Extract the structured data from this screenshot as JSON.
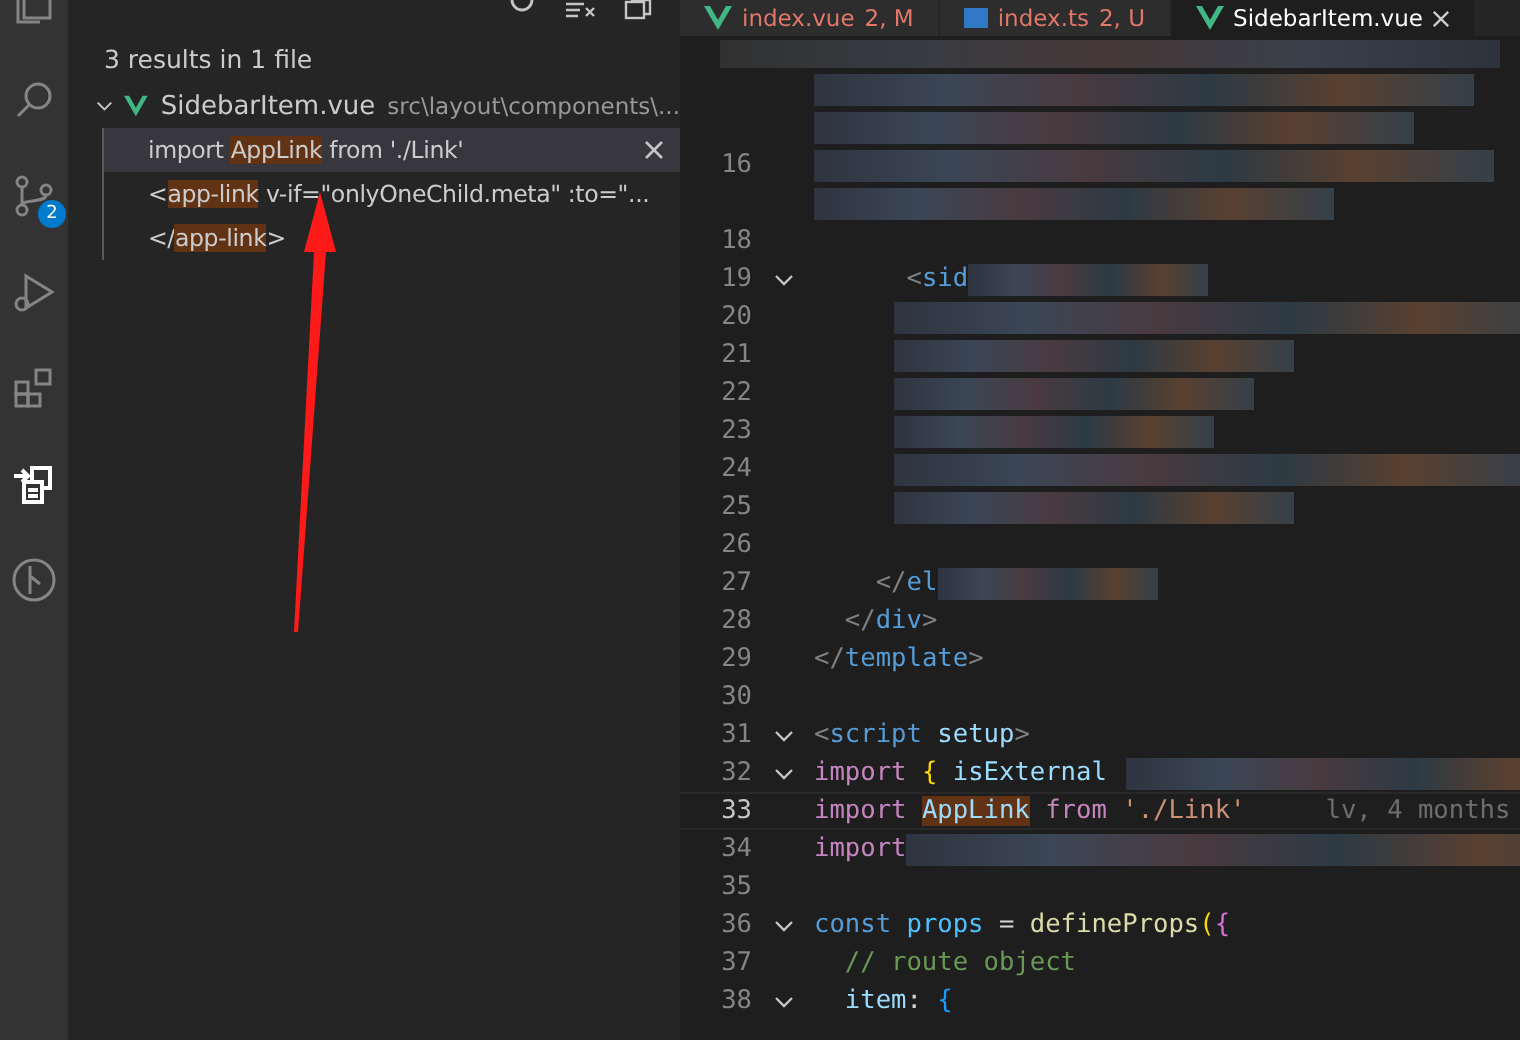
{
  "activity_bar": {
    "items": [
      {
        "kind": "files",
        "selected": false
      },
      {
        "kind": "search",
        "selected": false
      },
      {
        "kind": "source-control",
        "selected": false,
        "badge": "2"
      },
      {
        "kind": "run",
        "selected": false
      },
      {
        "kind": "extensions",
        "selected": false
      },
      {
        "kind": "references",
        "selected": true
      },
      {
        "kind": "git-graph",
        "selected": false
      }
    ]
  },
  "sidebar": {
    "summary": "3 results in 1 file",
    "file": {
      "name": "SidebarItem.vue",
      "path": "src\\layout\\components\\...",
      "expanded": true
    },
    "results": [
      {
        "selected": true,
        "segments": [
          {
            "kind": "plain",
            "text": "import "
          },
          {
            "kind": "match",
            "text": "AppLink"
          },
          {
            "kind": "plain",
            "text": " from './Link'"
          }
        ]
      },
      {
        "selected": false,
        "segments": [
          {
            "kind": "plain",
            "text": "<"
          },
          {
            "kind": "match",
            "text": "app-link"
          },
          {
            "kind": "plain",
            "text": " v-if=\"onlyOneChild.meta\" :to=\"..."
          }
        ]
      },
      {
        "selected": false,
        "segments": [
          {
            "kind": "plain",
            "text": "</"
          },
          {
            "kind": "match",
            "text": "app-link"
          },
          {
            "kind": "plain",
            "text": ">"
          }
        ]
      }
    ]
  },
  "tabs": [
    {
      "label": "index.vue",
      "status": "2, M",
      "kind": "vue",
      "selected": false
    },
    {
      "label": "index.ts",
      "status": "2, U",
      "kind": "ts",
      "selected": false
    },
    {
      "label": "SidebarItem.vue",
      "kind": "vue",
      "selected": true
    }
  ],
  "editor": {
    "lines": [
      {
        "fold": false,
        "current": false,
        "redacted": true
      },
      {
        "fold": false,
        "current": false,
        "redacted": true
      },
      {
        "number": "16",
        "fold": false,
        "current": false,
        "redacted": true
      },
      {
        "fold": false,
        "current": false,
        "redacted": true
      },
      {
        "number": "18",
        "fold": false,
        "current": false,
        "redacted": false
      },
      {
        "number": "19",
        "fold": true,
        "current": false,
        "redacted": true,
        "segments": [
          {
            "kind": "bracket",
            "text": "      <"
          },
          {
            "kind": "tag",
            "text": "sid"
          }
        ]
      },
      {
        "number": "20",
        "fold": false,
        "current": false,
        "redacted": true
      },
      {
        "number": "21",
        "fold": false,
        "current": false,
        "redacted": true
      },
      {
        "number": "22",
        "fold": false,
        "current": false,
        "redacted": true
      },
      {
        "number": "23",
        "fold": false,
        "current": false,
        "redacted": true
      },
      {
        "number": "24",
        "fold": false,
        "current": false,
        "redacted": true
      },
      {
        "number": "25",
        "fold": false,
        "current": false,
        "redacted": true
      },
      {
        "number": "26",
        "fold": false,
        "current": false,
        "redacted": false
      },
      {
        "number": "27",
        "fold": false,
        "current": false,
        "redacted": true,
        "segments": [
          {
            "kind": "bracket",
            "text": "    </"
          },
          {
            "kind": "tag",
            "text": "el"
          }
        ]
      },
      {
        "number": "28",
        "fold": false,
        "current": false,
        "redacted": false,
        "segments": [
          {
            "kind": "bracket",
            "text": "  </"
          },
          {
            "kind": "tag",
            "text": "div"
          },
          {
            "kind": "bracket",
            "text": ">"
          }
        ]
      },
      {
        "number": "29",
        "fold": false,
        "current": false,
        "redacted": false,
        "segments": [
          {
            "kind": "bracket",
            "text": "</"
          },
          {
            "kind": "tag",
            "text": "template"
          },
          {
            "kind": "bracket",
            "text": ">"
          }
        ]
      },
      {
        "number": "30",
        "fold": false,
        "current": false,
        "redacted": false
      },
      {
        "number": "31",
        "fold": true,
        "current": false,
        "redacted": false,
        "segments": [
          {
            "kind": "bracket",
            "text": "<"
          },
          {
            "kind": "tag",
            "text": "script"
          },
          {
            "kind": "variable",
            "text": " setup"
          },
          {
            "kind": "bracket",
            "text": ">"
          }
        ]
      },
      {
        "number": "32",
        "fold": true,
        "current": false,
        "redacted": true,
        "segments": [
          {
            "kind": "keyword",
            "text": "import "
          },
          {
            "kind": "brace",
            "text": "{ "
          },
          {
            "kind": "variable",
            "text": "isExternal"
          }
        ]
      },
      {
        "number": "33",
        "fold": false,
        "current": true,
        "redacted": false,
        "segments": [
          {
            "kind": "keyword",
            "text": "import "
          },
          {
            "kind": "match",
            "text": "AppLink"
          },
          {
            "kind": "keyword",
            "text": " from"
          },
          {
            "kind": "string",
            "text": " './Link'"
          },
          {
            "kind": "blame",
            "text": "lv, 4 months"
          }
        ]
      },
      {
        "number": "34",
        "fold": false,
        "current": false,
        "redacted": true,
        "segments": [
          {
            "kind": "keyword",
            "text": "import"
          }
        ]
      },
      {
        "number": "35",
        "fold": false,
        "current": false,
        "redacted": false
      },
      {
        "number": "36",
        "fold": true,
        "current": false,
        "redacted": false,
        "segments": [
          {
            "kind": "storage",
            "text": "const "
          },
          {
            "kind": "constant",
            "text": "props"
          },
          {
            "kind": "plain",
            "text": " = "
          },
          {
            "kind": "func",
            "text": "defineProps"
          },
          {
            "kind": "brace",
            "text": "("
          },
          {
            "kind": "brace2",
            "text": "{"
          }
        ]
      },
      {
        "number": "37",
        "fold": false,
        "current": false,
        "redacted": false,
        "segments": [
          {
            "kind": "comment",
            "text": "  // route object"
          }
        ]
      },
      {
        "number": "38",
        "fold": true,
        "current": false,
        "redacted": false,
        "segments": [
          {
            "kind": "variable",
            "text": "  item"
          },
          {
            "kind": "plain",
            "text": ": "
          },
          {
            "kind": "brace3",
            "text": "{"
          }
        ]
      }
    ]
  }
}
